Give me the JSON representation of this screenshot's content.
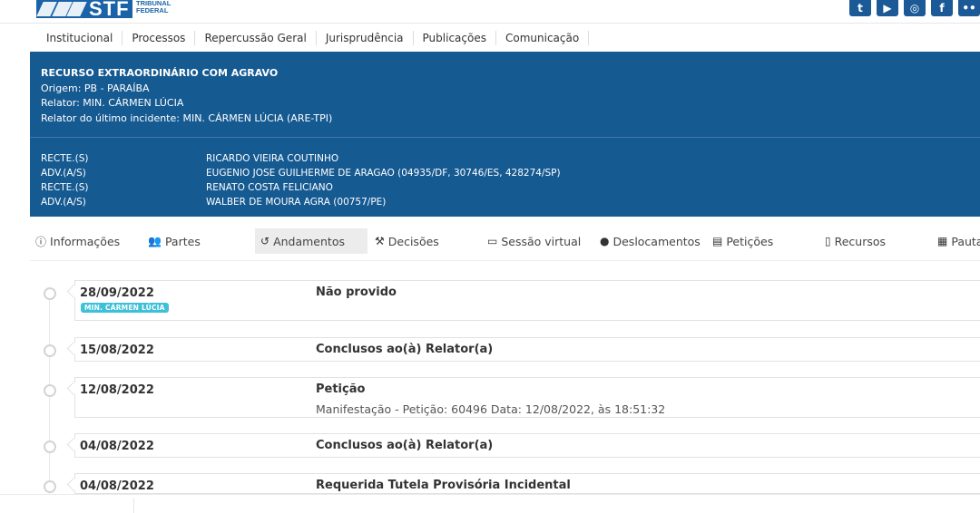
{
  "header": {
    "logo_text": "STF",
    "logo_sub_1": "TRIBUNAL",
    "logo_sub_2": "FEDERAL",
    "social": [
      "twitter-icon",
      "youtube-icon",
      "instagram-icon",
      "facebook-icon",
      "flickr-icon"
    ]
  },
  "nav": [
    "Institucional",
    "Processos",
    "Repercussão Geral",
    "Jurisprudência",
    "Publicações",
    "Comunicação"
  ],
  "process": {
    "title": "RECURSO EXTRAORDINÁRIO COM AGRAVO",
    "origem": "Origem: PB - PARAÍBA",
    "relator": "Relator: MIN. CÁRMEN LÚCIA",
    "relator_ultimo": "Relator do último incidente: MIN. CÁRMEN LÚCIA (ARE-TPI)"
  },
  "parties": [
    {
      "role": "RECTE.(S)",
      "name": "RICARDO VIEIRA COUTINHO"
    },
    {
      "role": "ADV.(A/S)",
      "name": "EUGENIO JOSE GUILHERME DE ARAGAO (04935/DF, 30746/ES, 428274/SP)"
    },
    {
      "role": "RECTE.(S)",
      "name": "RENATO COSTA FELICIANO"
    },
    {
      "role": "ADV.(A/S)",
      "name": "WALBER DE MOURA AGRA (00757/PE)"
    }
  ],
  "tabs": [
    {
      "label": "Informações",
      "icon": "info-icon"
    },
    {
      "label": "Partes",
      "icon": "users-icon"
    },
    {
      "label": "Andamentos",
      "icon": "history-icon",
      "active": true
    },
    {
      "label": "Decisões",
      "icon": "gavel-icon"
    },
    {
      "label": "Sessão virtual",
      "icon": "monitor-icon"
    },
    {
      "label": "Deslocamentos",
      "icon": "map-marker-icon"
    },
    {
      "label": "Petições",
      "icon": "file-pdf-icon"
    },
    {
      "label": "Recursos",
      "icon": "file-icon"
    },
    {
      "label": "Pauta",
      "icon": "calendar-icon"
    }
  ],
  "entries": [
    {
      "date": "28/09/2022",
      "description": "Não provido",
      "badge": "MIN. CÁRMEN LÚCIA",
      "detail": ""
    },
    {
      "date": "15/08/2022",
      "description": "Conclusos ao(à) Relator(a)",
      "badge": "",
      "detail": ""
    },
    {
      "date": "12/08/2022",
      "description": "Petição",
      "badge": "",
      "detail": "Manifestação - Petição: 60496 Data: 12/08/2022, às 18:51:32"
    },
    {
      "date": "04/08/2022",
      "description": "Conclusos ao(à) Relator(a)",
      "badge": "",
      "detail": ""
    },
    {
      "date": "04/08/2022",
      "description": "Requerida Tutela Provisória Incidental",
      "badge": "",
      "detail": ""
    }
  ]
}
